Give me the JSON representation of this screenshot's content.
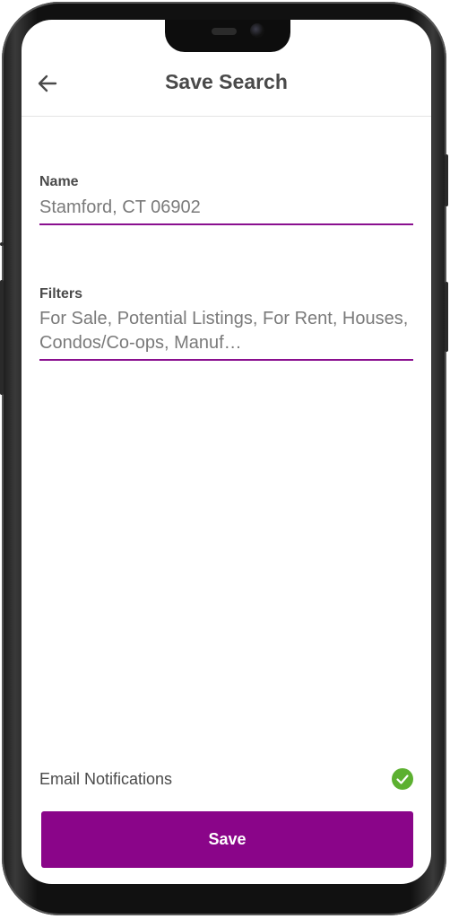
{
  "header": {
    "title": "Save Search",
    "back_icon": "arrow-left-icon"
  },
  "name_field": {
    "label": "Name",
    "value": "Stamford, CT 06902"
  },
  "filters_field": {
    "label": "Filters",
    "value": "For Sale, Potential Listings, For Rent, Houses, Condos/Co-ops, Manuf…"
  },
  "notifications": {
    "label": "Email Notifications",
    "enabled": true,
    "icon": "check-circle-icon"
  },
  "actions": {
    "save_label": "Save"
  },
  "colors": {
    "accent": "#8a0589",
    "underline": "#8a0f8f",
    "check": "#5cb030",
    "text_dark": "#4a4a4a",
    "text_value": "#7a7a7a"
  }
}
